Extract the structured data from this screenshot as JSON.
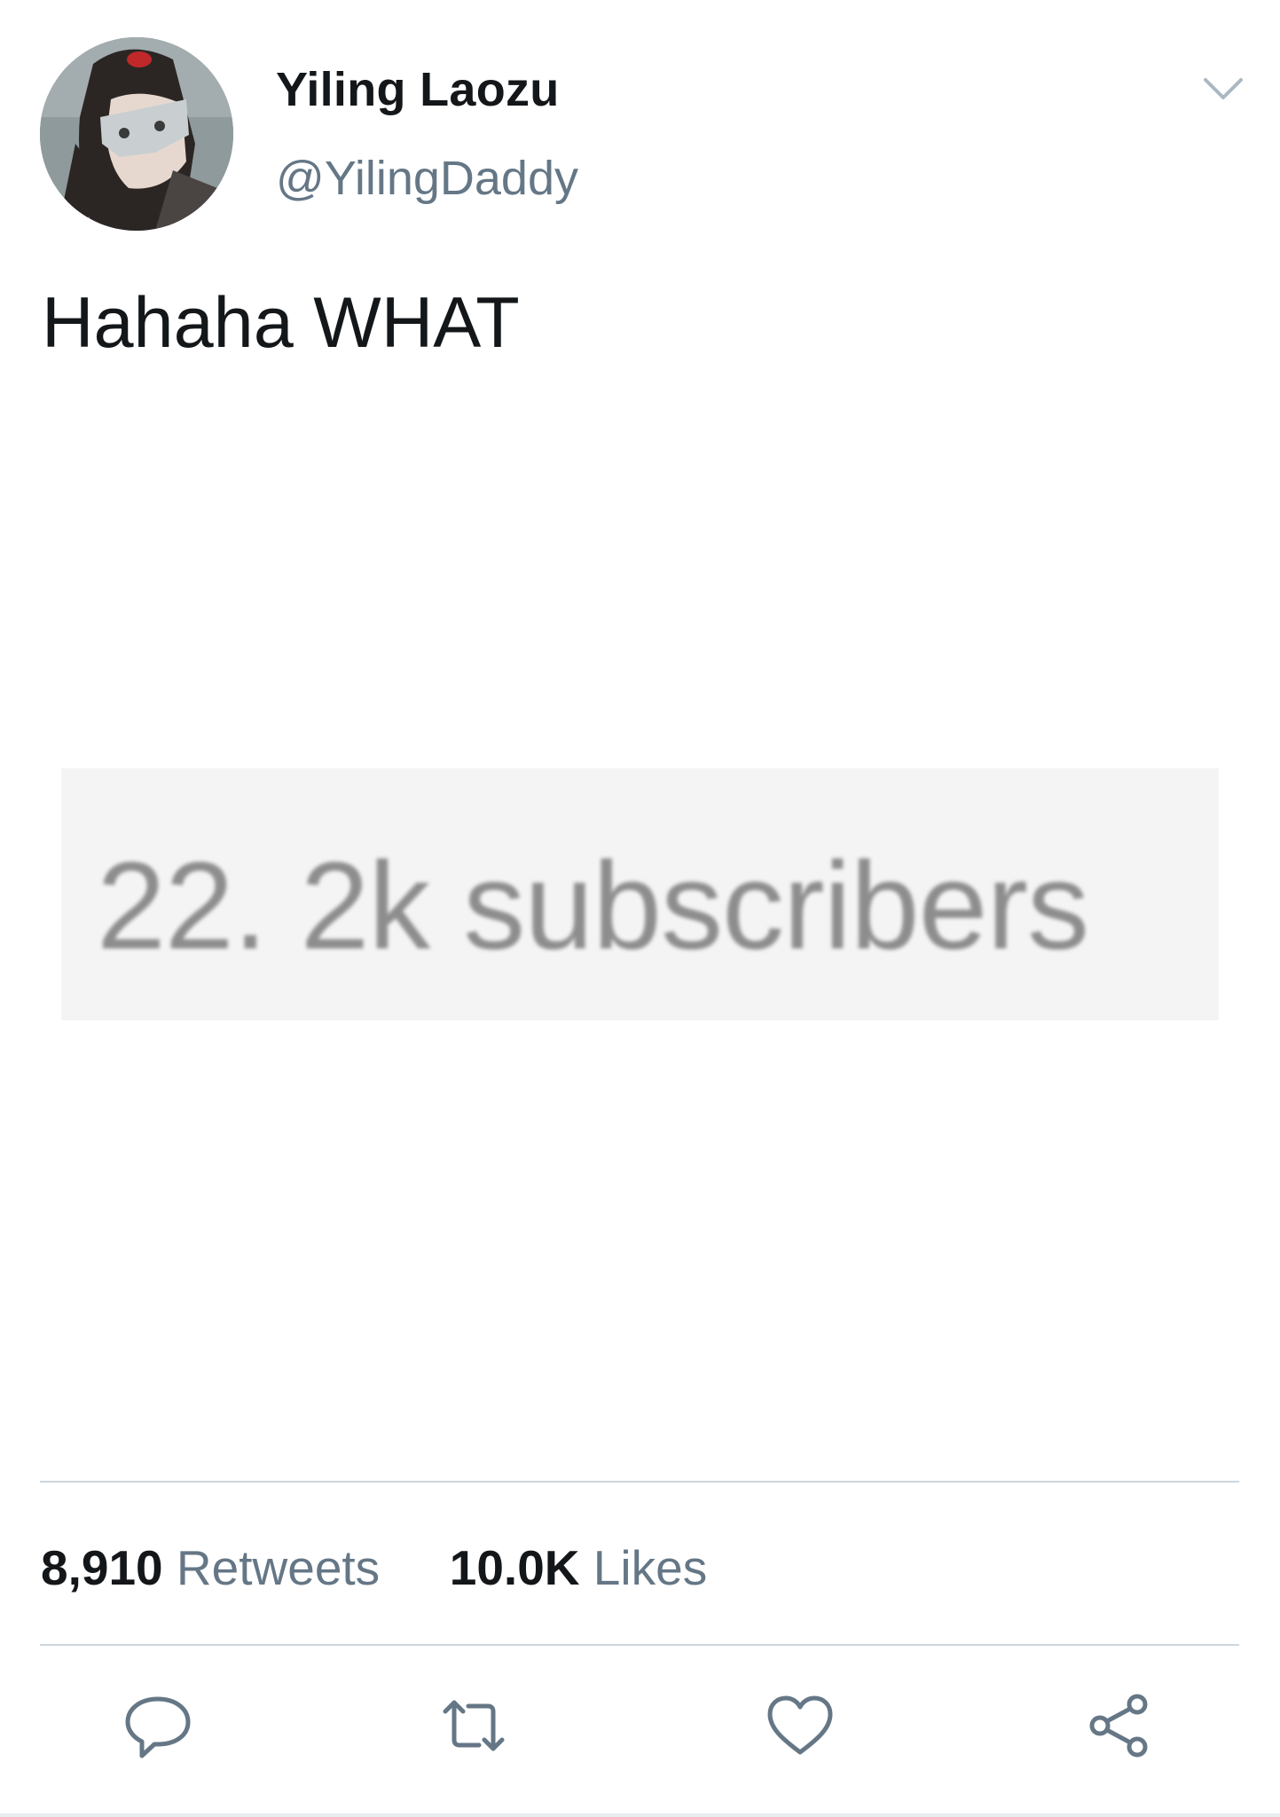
{
  "tweet": {
    "display_name": "Yiling Laozu",
    "handle": "@YilingDaddy",
    "text": "Hahaha WHAT",
    "media_text": "22. 2k subscribers"
  },
  "stats": {
    "retweets_count": "8,910",
    "retweets_label": "Retweets",
    "likes_count": "10.0K",
    "likes_label": "Likes"
  },
  "actions": [
    {
      "name": "reply",
      "icon": "speech-bubble-icon"
    },
    {
      "name": "retweet",
      "icon": "retweet-icon"
    },
    {
      "name": "like",
      "icon": "heart-icon"
    },
    {
      "name": "share",
      "icon": "share-icon"
    }
  ],
  "colors": {
    "primary_text": "#14171a",
    "secondary_text": "#657786",
    "divider": "#ccd6dd",
    "icon": "#657786"
  }
}
